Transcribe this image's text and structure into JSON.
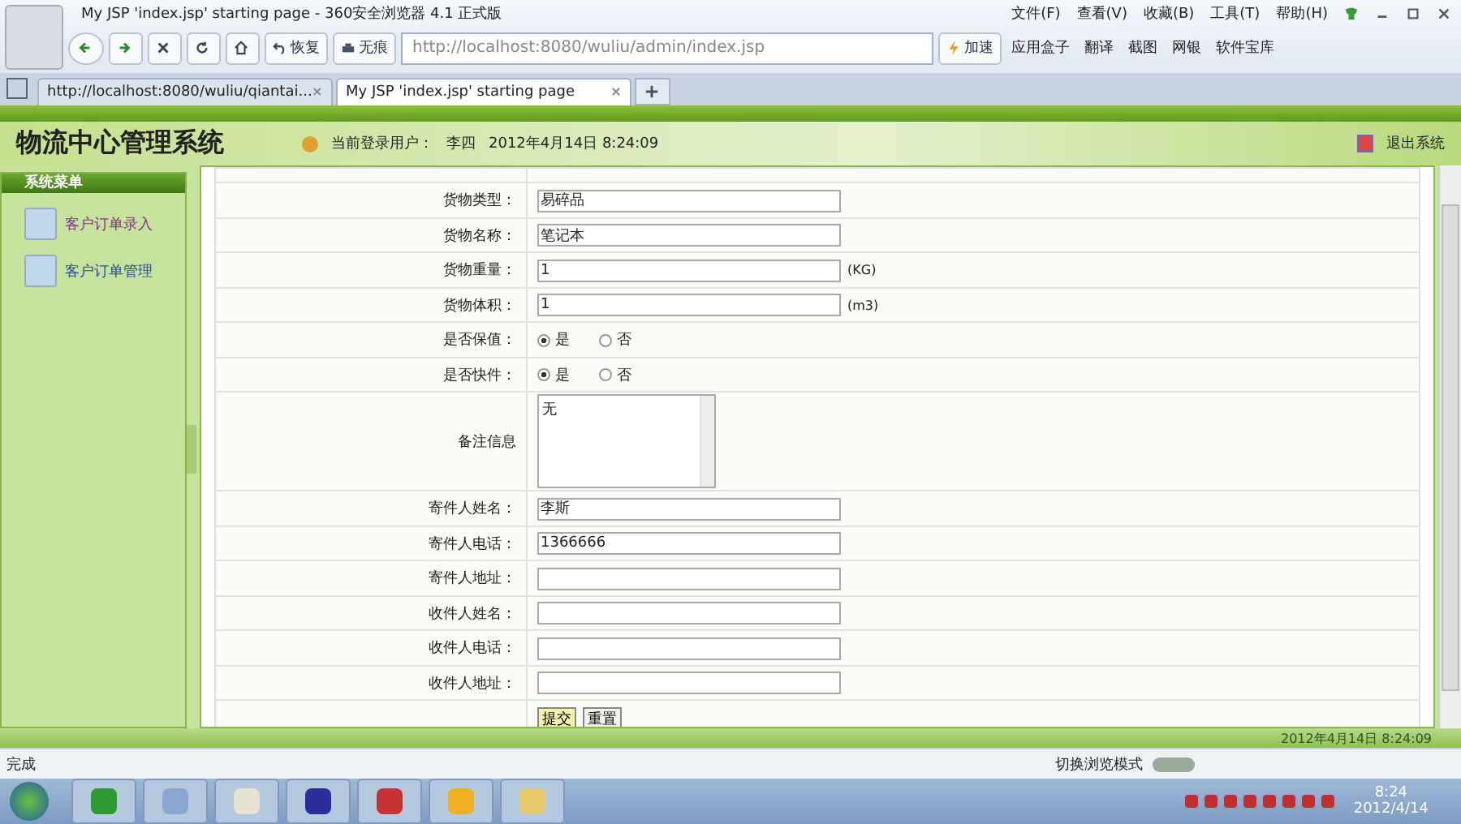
{
  "browser": {
    "title": "My JSP 'index.jsp' starting page - 360安全浏览器 4.1 正式版",
    "menu": [
      "文件(F)",
      "查看(V)",
      "收藏(B)",
      "工具(T)",
      "帮助(H)"
    ],
    "restore": "恢复",
    "incognito": "无痕",
    "url": "http://localhost:8080/wuliu/admin/index.jsp",
    "speedup": "加速",
    "tools": [
      "应用盒子",
      "翻译",
      "截图",
      "网银",
      "软件宝库"
    ],
    "tabs": [
      {
        "label": "http://localhost:8080/wuliu/qiantai...",
        "selected": false
      },
      {
        "label": "My JSP 'index.jsp' starting page",
        "selected": true
      }
    ],
    "status": "完成",
    "mode_switch": "切换浏览模式"
  },
  "app": {
    "title": "物流中心管理系统",
    "user_label": "当前登录用户：",
    "user": "李四",
    "datetime": "2012年4月14日  8:24:09",
    "logout": "退出系统"
  },
  "sidebar": {
    "header": "系统菜单",
    "items": [
      {
        "label": "客户订单录入",
        "visited": true
      },
      {
        "label": "客户订单管理",
        "visited": false
      }
    ]
  },
  "form": {
    "fields": [
      {
        "kind": "text",
        "label": "货物类型：",
        "value": "易碎品"
      },
      {
        "kind": "text",
        "label": "货物名称：",
        "value": "笔记本"
      },
      {
        "kind": "text",
        "label": "货物重量：",
        "value": "1",
        "unit": "(KG)"
      },
      {
        "kind": "text",
        "label": "货物体积：",
        "value": "1",
        "unit": "(m3)"
      },
      {
        "kind": "radio",
        "label": "是否保值：",
        "options": [
          {
            "label": "是",
            "selected": true
          },
          {
            "label": "否",
            "selected": false
          }
        ]
      },
      {
        "kind": "radio",
        "label": "是否快件：",
        "options": [
          {
            "label": "是",
            "selected": true
          },
          {
            "label": "否",
            "selected": false
          }
        ]
      },
      {
        "kind": "textarea",
        "label": "备注信息",
        "value": "无"
      },
      {
        "kind": "text",
        "label": "寄件人姓名：",
        "value": "李斯"
      },
      {
        "kind": "text",
        "label": "寄件人电话：",
        "value": "1366666"
      },
      {
        "kind": "text",
        "label": "寄件人地址："
      },
      {
        "kind": "text",
        "label": "收件人姓名："
      },
      {
        "kind": "text",
        "label": "收件人电话："
      },
      {
        "kind": "text",
        "label": "收件人地址："
      }
    ],
    "buttons": [
      {
        "label": "提交",
        "focused": true
      },
      {
        "label": "重置",
        "focused": false
      }
    ]
  },
  "footer": {
    "datetime": "2012年4月14日  8:24:09"
  },
  "taskbar": {
    "time": "8:24",
    "date": "2012/4/14"
  }
}
